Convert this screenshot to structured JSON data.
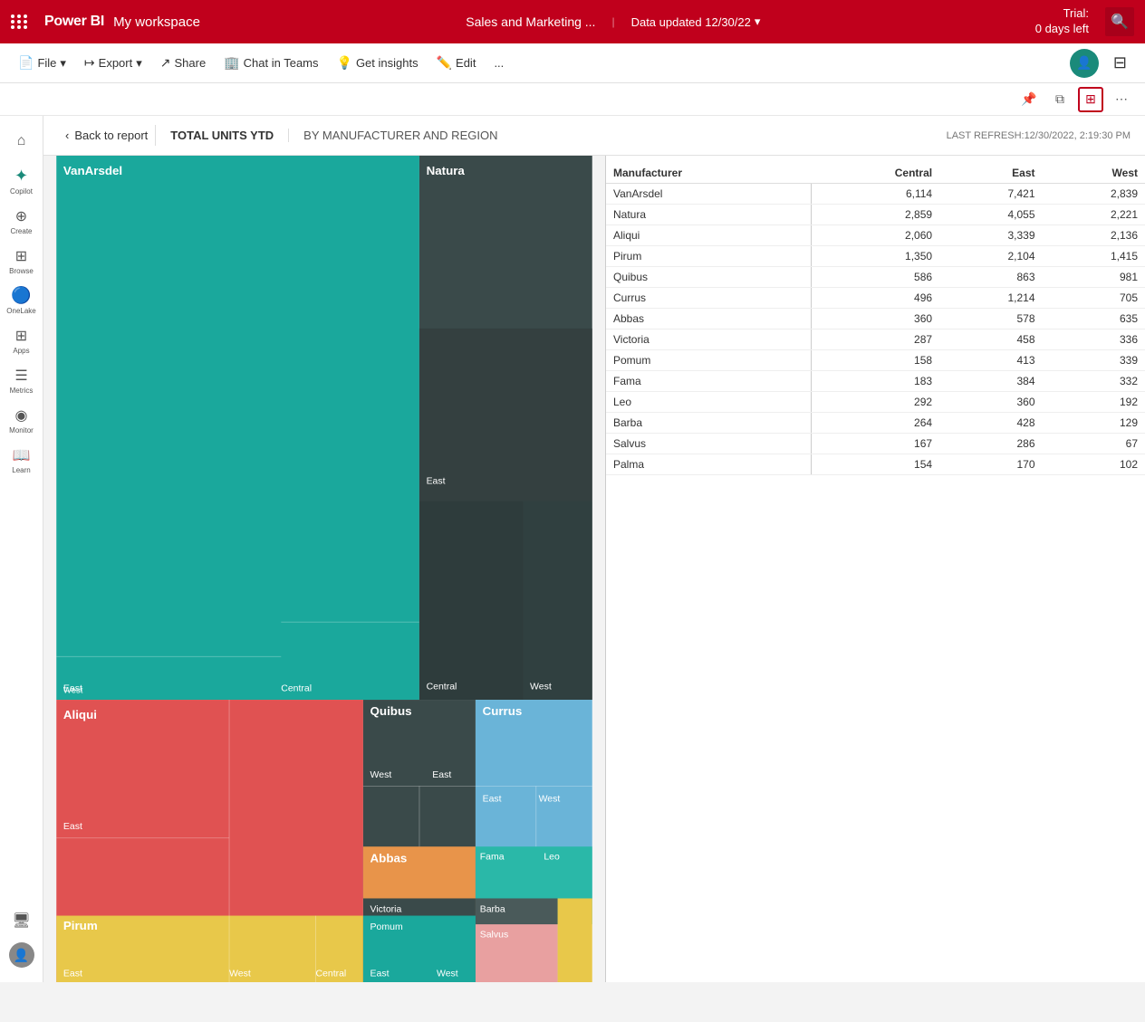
{
  "topbar": {
    "app_name": "Power BI",
    "workspace": "My workspace",
    "title": "Sales and Marketing ...",
    "refresh_label": "Data updated 12/30/22",
    "trial_line1": "Trial:",
    "trial_line2": "0 days left",
    "search_icon": "🔍"
  },
  "toolbar": {
    "file_label": "File",
    "export_label": "Export",
    "share_label": "Share",
    "chat_label": "Chat in Teams",
    "insights_label": "Get insights",
    "edit_label": "Edit",
    "more_label": "..."
  },
  "breadcrumb": {
    "back_label": "Back to report",
    "title": "TOTAL UNITS YTD",
    "subtitle": "BY MANUFACTURER AND REGION",
    "last_refresh": "LAST REFRESH:12/30/2022, 2:19:30 PM"
  },
  "sidebar": {
    "items": [
      {
        "id": "home",
        "icon": "⌂",
        "label": "Home"
      },
      {
        "id": "copilot",
        "icon": "✦",
        "label": "Copilot"
      },
      {
        "id": "create",
        "icon": "+",
        "label": "Create"
      },
      {
        "id": "browse",
        "icon": "⊞",
        "label": "Browse"
      },
      {
        "id": "onelake",
        "icon": "◎",
        "label": "OneLake"
      },
      {
        "id": "apps",
        "icon": "⊞",
        "label": "Apps"
      },
      {
        "id": "metrics",
        "icon": "≡",
        "label": "Metrics"
      },
      {
        "id": "monitor",
        "icon": "◎",
        "label": "Monitor"
      },
      {
        "id": "learn",
        "icon": "📖",
        "label": "Learn"
      }
    ]
  },
  "table": {
    "columns": [
      "Manufacturer",
      "Central",
      "East",
      "West"
    ],
    "rows": [
      {
        "manufacturer": "VanArsdel",
        "central": "6,114",
        "east": "7,421",
        "west": "2,839"
      },
      {
        "manufacturer": "Natura",
        "central": "2,859",
        "east": "4,055",
        "west": "2,221"
      },
      {
        "manufacturer": "Aliqui",
        "central": "2,060",
        "east": "3,339",
        "west": "2,136"
      },
      {
        "manufacturer": "Pirum",
        "central": "1,350",
        "east": "2,104",
        "west": "1,415"
      },
      {
        "manufacturer": "Quibus",
        "central": "586",
        "east": "863",
        "west": "981"
      },
      {
        "manufacturer": "Currus",
        "central": "496",
        "east": "1,214",
        "west": "705"
      },
      {
        "manufacturer": "Abbas",
        "central": "360",
        "east": "578",
        "west": "635"
      },
      {
        "manufacturer": "Victoria",
        "central": "287",
        "east": "458",
        "west": "336"
      },
      {
        "manufacturer": "Pomum",
        "central": "158",
        "east": "413",
        "west": "339"
      },
      {
        "manufacturer": "Fama",
        "central": "183",
        "east": "384",
        "west": "332"
      },
      {
        "manufacturer": "Leo",
        "central": "292",
        "east": "360",
        "west": "192"
      },
      {
        "manufacturer": "Barba",
        "central": "264",
        "east": "428",
        "west": "129"
      },
      {
        "manufacturer": "Salvus",
        "central": "167",
        "east": "286",
        "west": "67"
      },
      {
        "manufacturer": "Palma",
        "central": "154",
        "east": "170",
        "west": "102"
      }
    ]
  },
  "colors": {
    "teal": "#1AA89C",
    "dark_slate": "#3a4a4a",
    "red": "#e05252",
    "yellow": "#e8c84a",
    "blue": "#6ab4d8",
    "orange": "#e8944a",
    "pink": "#e8a0a0",
    "green_teal": "#2ab8a8",
    "accent_red": "#c0001c",
    "white": "#ffffff"
  }
}
